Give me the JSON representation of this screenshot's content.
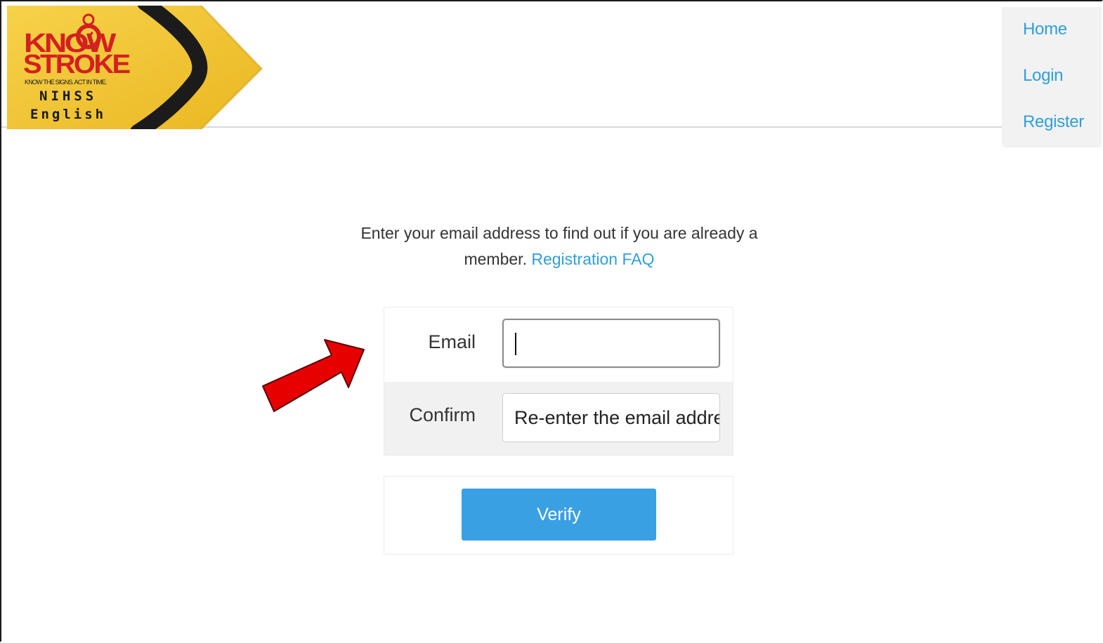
{
  "brand": {
    "logo_line1": "KNOW",
    "logo_line2": "STROKE",
    "tagline": "KNOW THE SIGNS. ACT IN TIME.",
    "product": "NIHSS",
    "language": "English"
  },
  "nav": {
    "items": [
      {
        "label": "Home"
      },
      {
        "label": "Login"
      },
      {
        "label": "Register"
      }
    ]
  },
  "intro": {
    "text": "Enter your email address to find out if you are already a member.",
    "link_label": "Registration FAQ"
  },
  "form": {
    "email_label": "Email",
    "email_value": "",
    "confirm_label": "Confirm",
    "confirm_placeholder": "Re-enter the email address",
    "submit_label": "Verify"
  },
  "annotation": {
    "pointer": "red-arrow-icon"
  },
  "colors": {
    "link": "#2f9ee0",
    "button": "#3aa0e4",
    "logo_red": "#e02020",
    "logo_yellow": "#f3c531",
    "arrow_red": "#e60000"
  }
}
